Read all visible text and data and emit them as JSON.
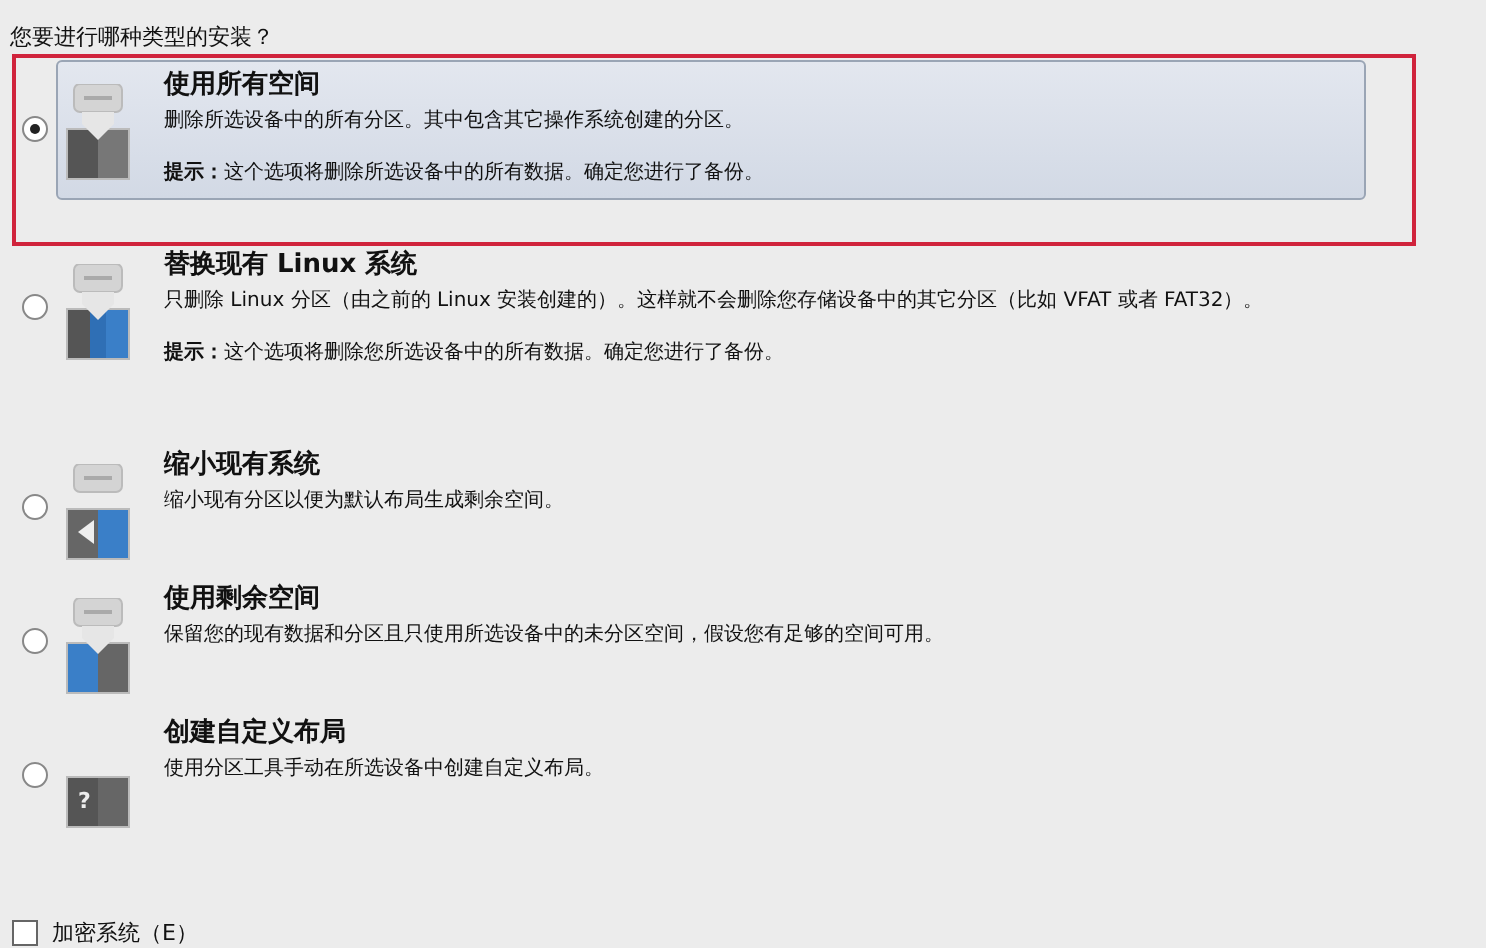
{
  "question": "您要进行哪种类型的安装？",
  "options": [
    {
      "kind": "wipe",
      "title": "使用所有空间",
      "description": "删除所选设备中的所有分区。其中包含其它操作系统创建的分区。",
      "hint": "**提示：**这个选项将删除所选设备中的所有数据。确定您进行了备份。",
      "selected": true
    },
    {
      "kind": "linux",
      "title": "替换现有 Linux 系统",
      "description": "只删除 Linux 分区（由之前的 Linux 安装创建的）。这样就不会删除您存储设备中的其它分区（比如 VFAT 或者 FAT32）。",
      "hint": "**提示：**这个选项将删除您所选设备中的所有数据。确定您进行了备份。",
      "selected": false
    },
    {
      "kind": "shrink",
      "title": "缩小现有系统",
      "description": "缩小现有分区以便为默认布局生成剩余空间。",
      "selected": false
    },
    {
      "kind": "free",
      "title": "使用剩余空间",
      "description": "保留您的现有数据和分区且只使用所选设备中的未分区空间，假设您有足够的空间可用。",
      "selected": false
    },
    {
      "kind": "custom",
      "badge": "?",
      "title": "创建自定义布局",
      "description": "使用分区工具手动在所选设备中创建自定义布局。",
      "selected": false
    }
  ],
  "encrypt": {
    "label": "加密系统（E）",
    "checked": false
  }
}
